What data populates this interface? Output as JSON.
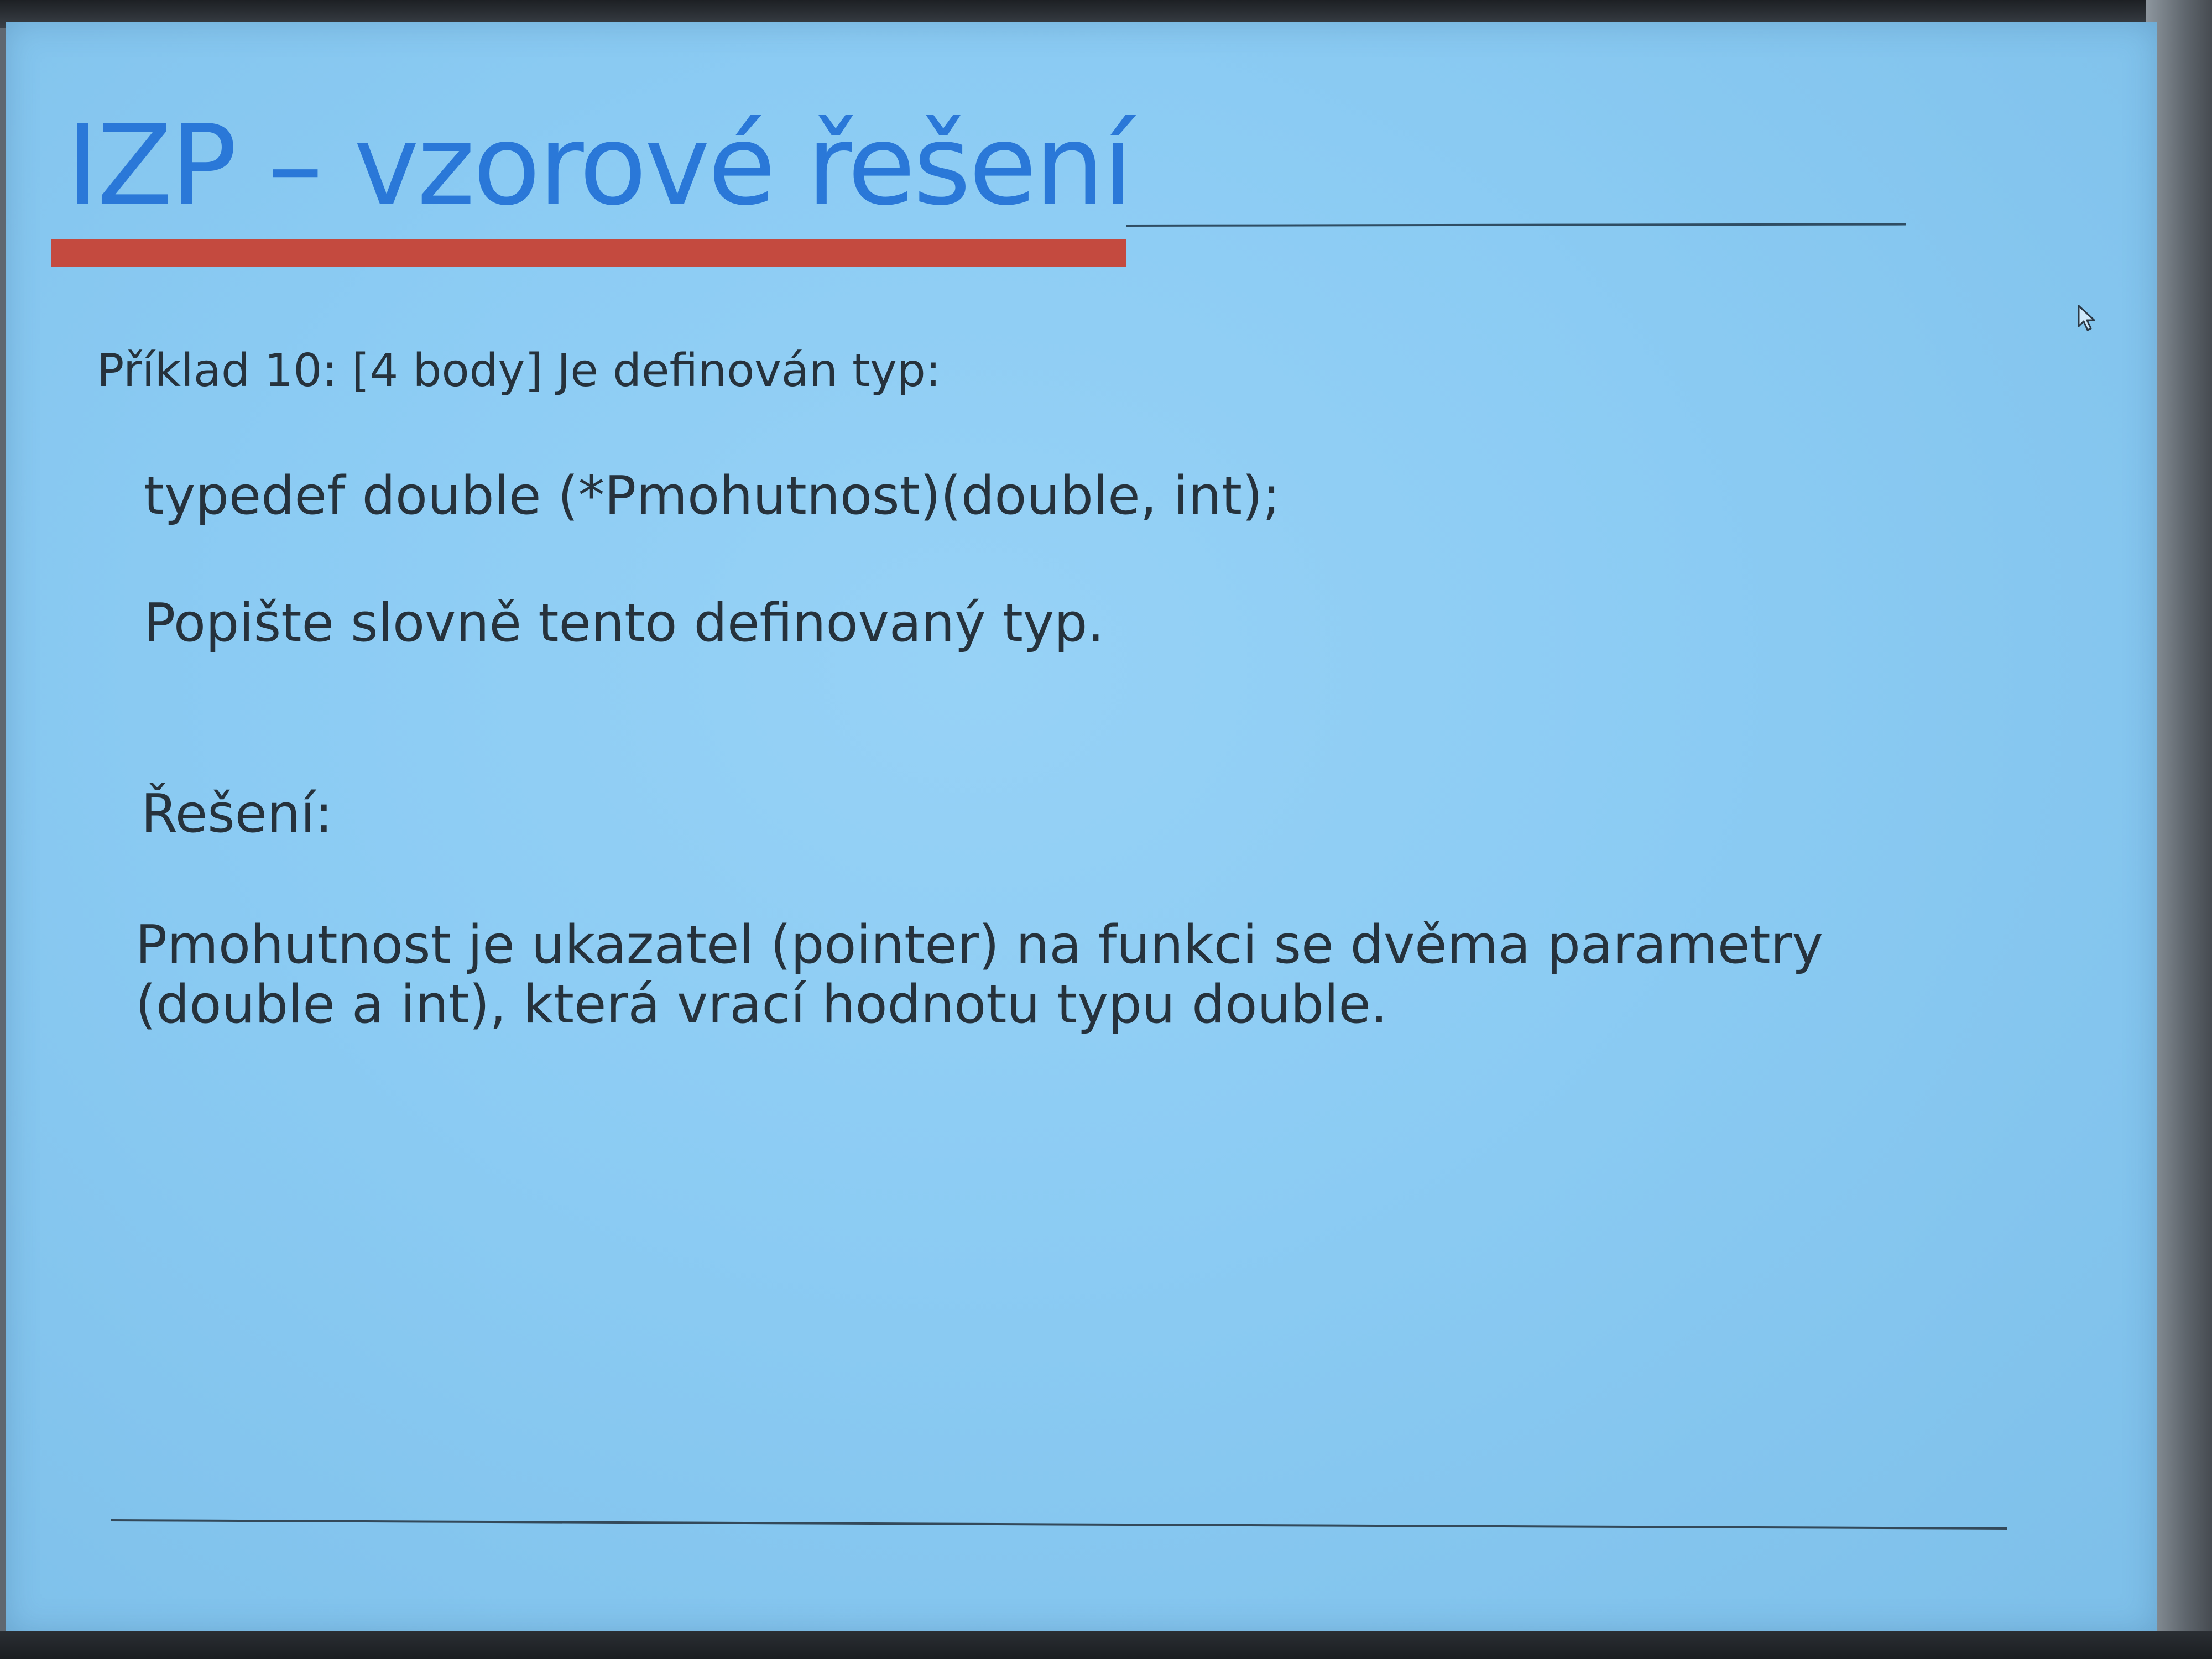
{
  "slide": {
    "title": "IZP – vzorové řešení",
    "question_label": "Příklad 10: [4 body] Je definován typ:",
    "code": "typedef double (*Pmohutnost)(double, int);",
    "task": "Popište slovně tento definovaný typ.",
    "solution_label": "Řešení:",
    "answer": "Pmohutnost je ukazatel (pointer) na funkci se dvěma parametry (double a int), která vrací hodnotu typu double."
  },
  "colors": {
    "slide_background": "#8bcbf3",
    "title_text": "#2a78d8",
    "title_underline": "#c44a3f",
    "body_text": "#26323c"
  },
  "icons": {
    "pointer": "mouse-cursor-icon"
  }
}
